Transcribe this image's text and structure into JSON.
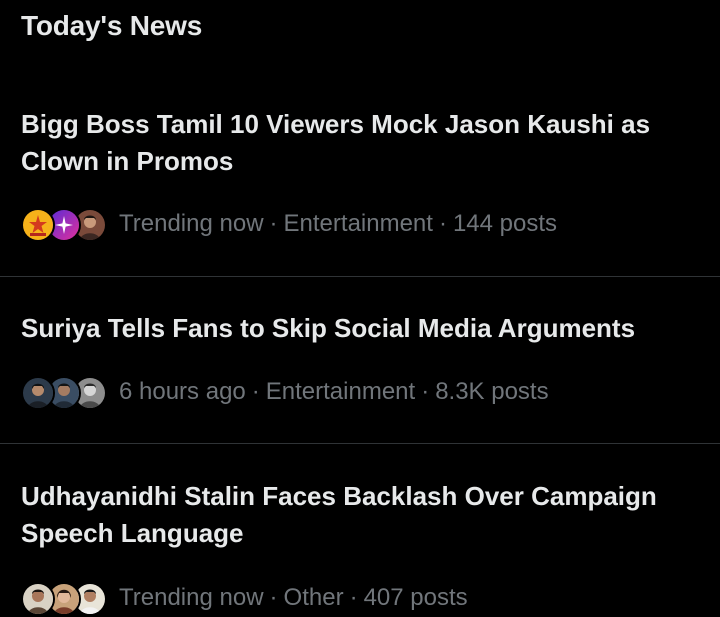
{
  "section": {
    "title": "Today's News"
  },
  "items": [
    {
      "headline": "Bigg Boss Tamil 10 Viewers Mock Jason Kaushi as Clown in Promos",
      "time": "Trending now",
      "category": "Entertainment",
      "posts": "144 posts",
      "avatars": [
        "channel-logo-avatar",
        "star-logo-avatar",
        "person-avatar"
      ]
    },
    {
      "headline": "Suriya Tells Fans to Skip Social Media Arguments",
      "time": "6 hours ago",
      "category": "Entertainment",
      "posts": "8.3K posts",
      "avatars": [
        "person-avatar",
        "person-avatar",
        "person-avatar"
      ]
    },
    {
      "headline": "Udhayanidhi Stalin Faces Backlash Over Campaign Speech Language",
      "time": "Trending now",
      "category": "Other",
      "posts": "407 posts",
      "avatars": [
        "person-avatar",
        "person-avatar",
        "person-avatar"
      ]
    }
  ],
  "separator": "·",
  "colors": {
    "background": "#000000",
    "primary_text": "#e7e9ea",
    "secondary_text": "#71767b",
    "divider": "#2f3336"
  }
}
